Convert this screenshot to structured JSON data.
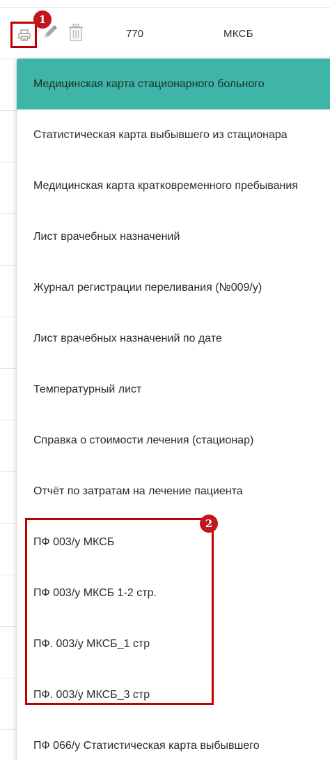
{
  "table_row": {
    "number": "770",
    "type": "МКСБ"
  },
  "icons": {
    "print": "printer-icon",
    "edit": "pencil-icon",
    "delete": "trash-icon"
  },
  "annotations": {
    "step1": "1",
    "step2": "2"
  },
  "colors": {
    "active_item": "#3eb5a6",
    "annotation_red": "#c00000"
  },
  "menu": {
    "items": [
      {
        "label": "Медицинская карта стационарного больного",
        "active": true
      },
      {
        "label": "Статистическая карта выбывшего из стационара",
        "active": false
      },
      {
        "label": "Медицинская карта кратковременного пребывания",
        "active": false
      },
      {
        "label": "Лист врачебных назначений",
        "active": false
      },
      {
        "label": "Журнал регистрации переливания (№009/у)",
        "active": false
      },
      {
        "label": "Лист врачебных назначений по дате",
        "active": false
      },
      {
        "label": "Температурный лист",
        "active": false
      },
      {
        "label": "Справка о стоимости лечения (стационар)",
        "active": false
      },
      {
        "label": "Отчёт по затратам на лечение пациента",
        "active": false
      },
      {
        "label": "ПФ 003/у МКСБ",
        "active": false
      },
      {
        "label": "ПФ 003/у МКСБ 1-2 стр.",
        "active": false
      },
      {
        "label": "ПФ. 003/у МКСБ_1 стр",
        "active": false
      },
      {
        "label": "ПФ. 003/у МКСБ_3 стр",
        "active": false
      },
      {
        "label": "ПФ 066/у Статистическая карта выбывшего",
        "active": false
      }
    ]
  }
}
